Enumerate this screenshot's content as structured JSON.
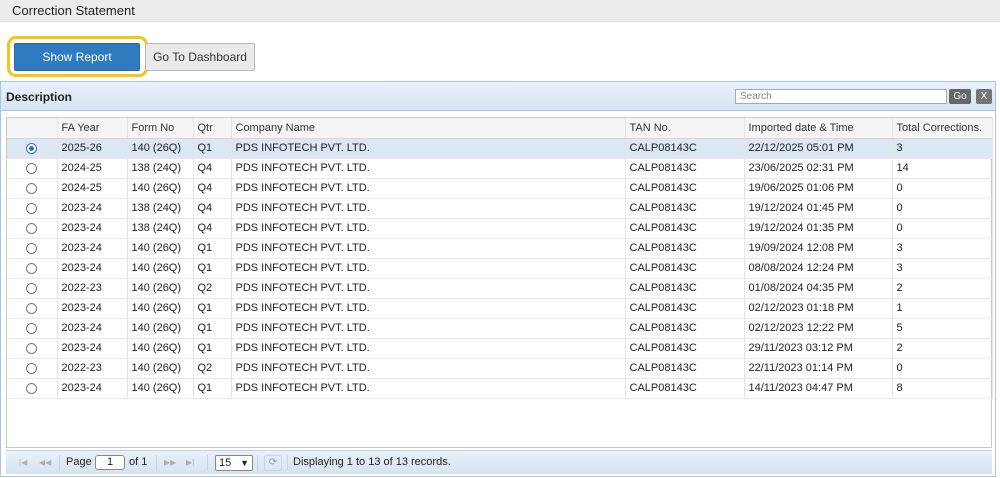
{
  "header": {
    "title": "Correction Statement"
  },
  "toolbar": {
    "show_report_label": "Show Report",
    "dashboard_label": "Go To Dashboard"
  },
  "panel": {
    "title": "Description",
    "search_placeholder": "Search",
    "go_label": "Go",
    "clear_label": "X"
  },
  "table": {
    "columns": [
      "FA Year",
      "Form No",
      "Qtr",
      "Company Name",
      "TAN No.",
      "Imported date & Time",
      "Total Corrections."
    ],
    "rows": [
      {
        "selected": true,
        "fa_year": "2025-26",
        "form_no": "140 (26Q)",
        "qtr": "Q1",
        "company": "PDS INFOTECH PVT. LTD.",
        "tan": "CALP08143C",
        "imported": "22/12/2025 05:01 PM",
        "total": "3"
      },
      {
        "selected": false,
        "fa_year": "2024-25",
        "form_no": "138 (24Q)",
        "qtr": "Q4",
        "company": "PDS INFOTECH PVT. LTD.",
        "tan": "CALP08143C",
        "imported": "23/06/2025 02:31 PM",
        "total": "14"
      },
      {
        "selected": false,
        "fa_year": "2024-25",
        "form_no": "140 (26Q)",
        "qtr": "Q4",
        "company": "PDS INFOTECH PVT. LTD.",
        "tan": "CALP08143C",
        "imported": "19/06/2025 01:06 PM",
        "total": "0"
      },
      {
        "selected": false,
        "fa_year": "2023-24",
        "form_no": "138 (24Q)",
        "qtr": "Q4",
        "company": "PDS INFOTECH PVT. LTD.",
        "tan": "CALP08143C",
        "imported": "19/12/2024 01:45 PM",
        "total": "0"
      },
      {
        "selected": false,
        "fa_year": "2023-24",
        "form_no": "138 (24Q)",
        "qtr": "Q4",
        "company": "PDS INFOTECH PVT. LTD.",
        "tan": "CALP08143C",
        "imported": "19/12/2024 01:35 PM",
        "total": "0"
      },
      {
        "selected": false,
        "fa_year": "2023-24",
        "form_no": "140 (26Q)",
        "qtr": "Q1",
        "company": "PDS INFOTECH PVT. LTD.",
        "tan": "CALP08143C",
        "imported": "19/09/2024 12:08 PM",
        "total": "3"
      },
      {
        "selected": false,
        "fa_year": "2023-24",
        "form_no": "140 (26Q)",
        "qtr": "Q1",
        "company": "PDS INFOTECH PVT. LTD.",
        "tan": "CALP08143C",
        "imported": "08/08/2024 12:24 PM",
        "total": "3"
      },
      {
        "selected": false,
        "fa_year": "2022-23",
        "form_no": "140 (26Q)",
        "qtr": "Q2",
        "company": "PDS INFOTECH PVT. LTD.",
        "tan": "CALP08143C",
        "imported": "01/08/2024 04:35 PM",
        "total": "2"
      },
      {
        "selected": false,
        "fa_year": "2023-24",
        "form_no": "140 (26Q)",
        "qtr": "Q1",
        "company": "PDS INFOTECH PVT. LTD.",
        "tan": "CALP08143C",
        "imported": "02/12/2023 01:18 PM",
        "total": "1"
      },
      {
        "selected": false,
        "fa_year": "2023-24",
        "form_no": "140 (26Q)",
        "qtr": "Q1",
        "company": "PDS INFOTECH PVT. LTD.",
        "tan": "CALP08143C",
        "imported": "02/12/2023 12:22 PM",
        "total": "5"
      },
      {
        "selected": false,
        "fa_year": "2023-24",
        "form_no": "140 (26Q)",
        "qtr": "Q1",
        "company": "PDS INFOTECH PVT. LTD.",
        "tan": "CALP08143C",
        "imported": "29/11/2023 03:12 PM",
        "total": "2"
      },
      {
        "selected": false,
        "fa_year": "2022-23",
        "form_no": "140 (26Q)",
        "qtr": "Q2",
        "company": "PDS INFOTECH PVT. LTD.",
        "tan": "CALP08143C",
        "imported": "22/11/2023 01:14 PM",
        "total": "0"
      },
      {
        "selected": false,
        "fa_year": "2023-24",
        "form_no": "140 (26Q)",
        "qtr": "Q1",
        "company": "PDS INFOTECH PVT. LTD.",
        "tan": "CALP08143C",
        "imported": "14/11/2023 04:47 PM",
        "total": "8"
      }
    ]
  },
  "pager": {
    "page_label": "Page",
    "page_value": "1",
    "of_label": "of 1",
    "page_size": "15",
    "status": "Displaying 1 to 13 of 13 records."
  },
  "colors": {
    "primary_button": "#2f7bbf",
    "highlight": "#f5c518",
    "selected_row": "#dbe7f5"
  }
}
